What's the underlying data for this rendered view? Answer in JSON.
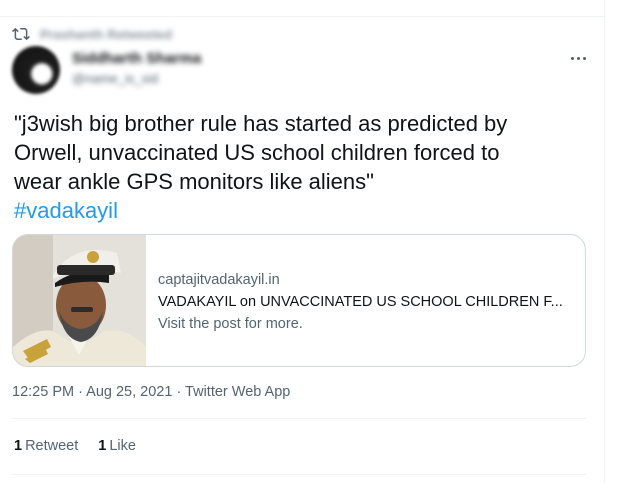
{
  "retweet_header": {
    "text": "Prashanth Retweeted"
  },
  "author": {
    "name": "Siddharth Sharma",
    "handle": "@name_is_sid"
  },
  "tweet": {
    "line1": "\"j3wish big brother rule has started as predicted by",
    "line2": "Orwell, unvaccinated US school children forced to",
    "line3": "wear ankle GPS monitors like aliens\"",
    "hashtag": "#vadakayil"
  },
  "link_card": {
    "domain": "captajitvadakayil.in",
    "title": "VADAKAYIL on UNVACCINATED US SCHOOL CHILDREN F...",
    "description": "Visit the post for more."
  },
  "meta": {
    "timestamp": "12:25 PM · Aug 25, 2021 · Twitter Web App"
  },
  "stats": {
    "retweets_count": "1",
    "retweets_label": "Retweet",
    "likes_count": "1",
    "likes_label": "Like"
  },
  "colors": {
    "link": "#1d9bf0",
    "secondary": "#536471",
    "border": "#cfd9de"
  },
  "icons": {
    "retweet": "retweet-icon",
    "more": "more-icon"
  }
}
